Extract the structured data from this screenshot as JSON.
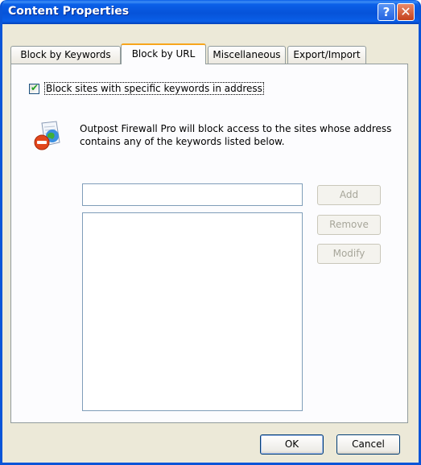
{
  "window": {
    "title": "Content Properties",
    "help_label": "?",
    "close_label": "✕"
  },
  "tabs": [
    {
      "label": "Block by Keywords",
      "active": false
    },
    {
      "label": "Block by URL",
      "active": true
    },
    {
      "label": "Miscellaneous",
      "active": false
    },
    {
      "label": "Export/Import",
      "active": false
    }
  ],
  "panel": {
    "checkbox_label": "Block sites with specific keywords in address",
    "checkbox_checked": true,
    "description": "Outpost Firewall Pro will block access to the sites whose address contains any of the keywords listed below.",
    "url_input_value": "",
    "url_list_items": [],
    "add_label": "Add",
    "remove_label": "Remove",
    "modify_label": "Modify"
  },
  "footer": {
    "ok_label": "OK",
    "cancel_label": "Cancel"
  }
}
